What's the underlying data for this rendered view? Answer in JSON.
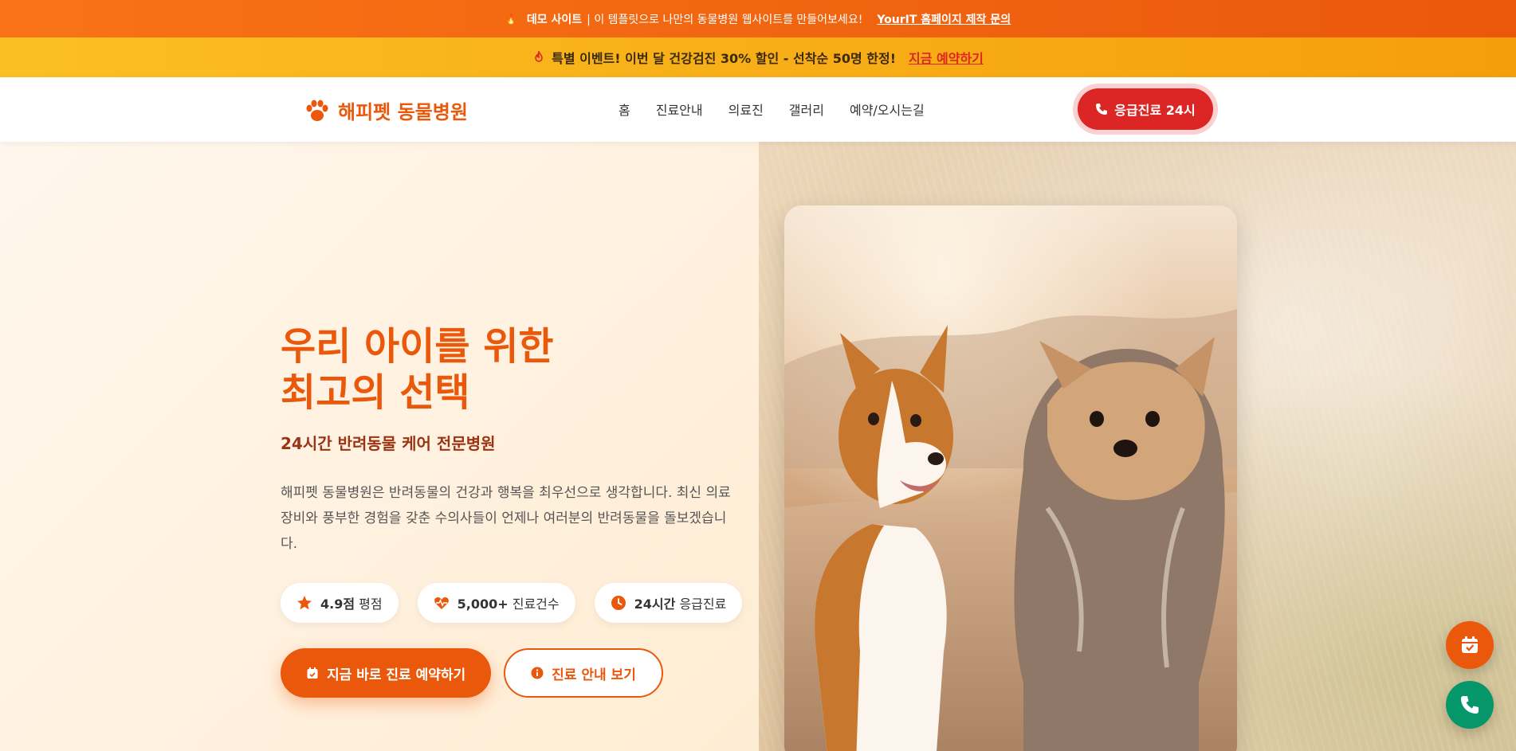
{
  "demo_bar": {
    "fire_icon": "🔥",
    "bold_text": "데모 사이트",
    "text": "| 이 템플릿으로 나만의 동물병원 웹사이트를 만들어보세요!",
    "link": "YourIT 홈페이지 제작 문의"
  },
  "event_bar": {
    "text": "특별 이벤트! 이번 달 건강검진 30% 할인 - 선착순 50명 한정!",
    "link": "지금 예약하기"
  },
  "header": {
    "logo": "해피펫 동물병원",
    "nav": [
      "홈",
      "진료안내",
      "의료진",
      "갤러리",
      "예약/오시는길"
    ],
    "emergency": "응급진료 24시"
  },
  "hero": {
    "title": "우리 아이를 위한\n최고의 선택",
    "subtitle": "24시간 반려동물 케어 전문병원",
    "description": "해피펫 동물병원은 반려동물의 건강과 행복을 최우선으로 생각합니다. 최신 의료 장비와 풍부한 경험을 갖춘 수의사들이 언제나 여러분의 반려동물을 돌보겠습니다.",
    "stats": [
      {
        "bold": "4.9점",
        "label": "평점",
        "icon": "star-icon"
      },
      {
        "bold": "5,000+",
        "label": "진료건수",
        "icon": "heartbeat-icon"
      },
      {
        "bold": "24시간",
        "label": "응급진료",
        "icon": "clock-icon"
      }
    ],
    "primary_cta": "지금 바로 진료 예약하기",
    "secondary_cta": "진료 안내 보기"
  },
  "colors": {
    "brand": "#ea580c",
    "emergency": "#dc2626",
    "phone_fab": "#059669"
  }
}
